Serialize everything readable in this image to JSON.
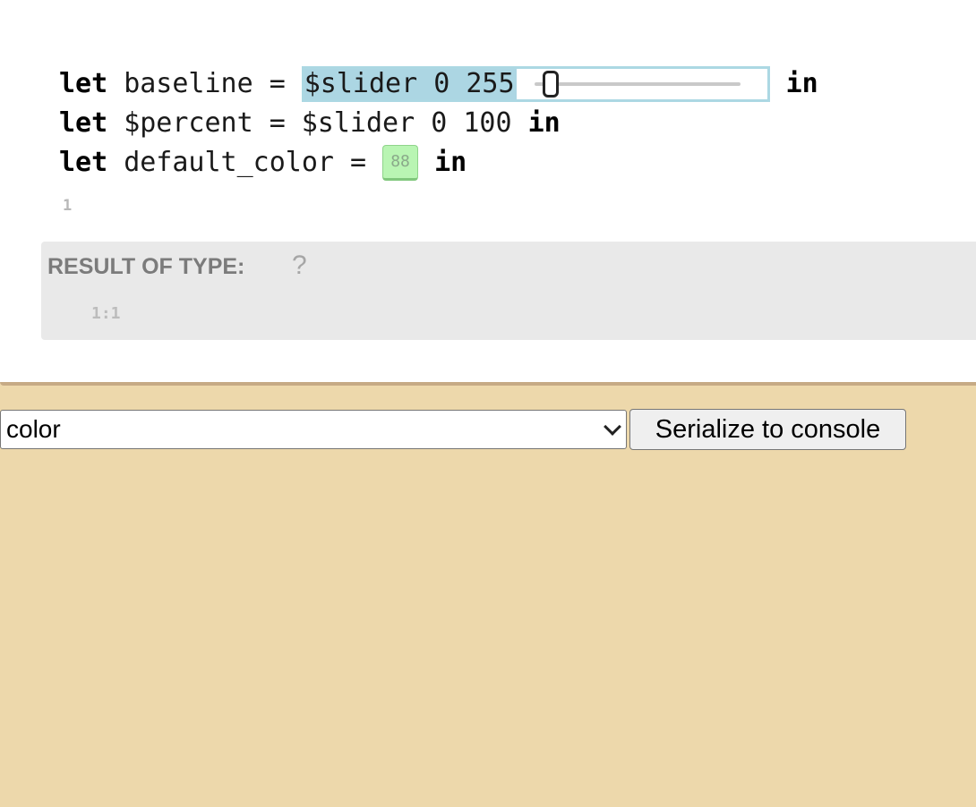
{
  "editor": {
    "line1": {
      "kw_let": "let",
      "name": "baseline",
      "eq": "=",
      "expr": "$slider 0 255",
      "slider_value": 0.08,
      "kw_in": "in"
    },
    "line2": {
      "kw_let": "let",
      "name": "$percent",
      "eq": "=",
      "expr": "$slider 0 100",
      "kw_in": "in"
    },
    "line3": {
      "kw_let": "let",
      "name": "default_color",
      "eq": "=",
      "chip_value": "88",
      "chip_color": "#b9f5b3",
      "kw_in": "in"
    },
    "body_line_number": "1"
  },
  "result": {
    "label": "RESULT OF TYPE:",
    "type": "?",
    "position": "1:1"
  },
  "controls": {
    "select_value": "color",
    "serialize_label": "Serialize to console"
  },
  "colors": {
    "background": "#edd8ab",
    "slider_highlight": "#acd6e3",
    "result_panel": "#e9e9e9"
  },
  "icons": {
    "select_arrow": "chevron-down-icon",
    "slider_thumb": "slider-thumb"
  }
}
